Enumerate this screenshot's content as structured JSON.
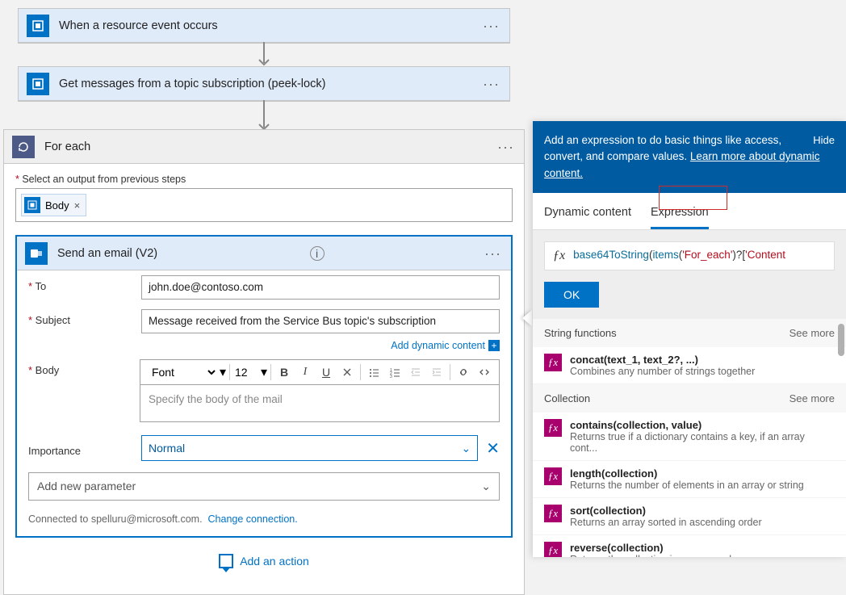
{
  "trigger": {
    "title": "When a resource event occurs"
  },
  "action1": {
    "title": "Get messages from a topic subscription (peek-lock)"
  },
  "foreach": {
    "title": "For each",
    "output_label": "Select an output from previous steps",
    "token": "Body"
  },
  "email": {
    "title": "Send an email (V2)",
    "to_label": "To",
    "to_value": "john.doe@contoso.com",
    "subject_label": "Subject",
    "subject_value": "Message received from the Service Bus topic's subscription",
    "add_dynamic": "Add dynamic content",
    "body_label": "Body",
    "font_label": "Font",
    "font_size": "12",
    "body_placeholder": "Specify the body of the mail",
    "importance_label": "Importance",
    "importance_value": "Normal",
    "param_label": "Add new parameter",
    "connected_prefix": "Connected to spelluru@microsoft.com.",
    "change_conn": "Change connection."
  },
  "add_action": "Add an action",
  "panel": {
    "intro_1": "Add an expression to do basic things like access, convert, and compare values. ",
    "learn": "Learn more about dynamic content.",
    "hide": "Hide",
    "tab_dynamic": "Dynamic content",
    "tab_expr": "Expression",
    "expr_fn": "base64ToString",
    "expr_items": "items",
    "expr_arg1": "'For_each'",
    "expr_tail_raw": ")?[",
    "expr_arg2": "'Content",
    "ok": "OK",
    "sections": [
      {
        "title": "String functions",
        "more": "See more",
        "items": [
          {
            "name": "concat(text_1, text_2?, ...)",
            "desc": "Combines any number of strings together"
          }
        ]
      },
      {
        "title": "Collection",
        "more": "See more",
        "items": [
          {
            "name": "contains(collection, value)",
            "desc": "Returns true if a dictionary contains a key, if an array cont..."
          },
          {
            "name": "length(collection)",
            "desc": "Returns the number of elements in an array or string"
          },
          {
            "name": "sort(collection)",
            "desc": "Returns an array sorted in ascending order"
          },
          {
            "name": "reverse(collection)",
            "desc": "Returns the collection in reverse order"
          }
        ]
      }
    ]
  }
}
